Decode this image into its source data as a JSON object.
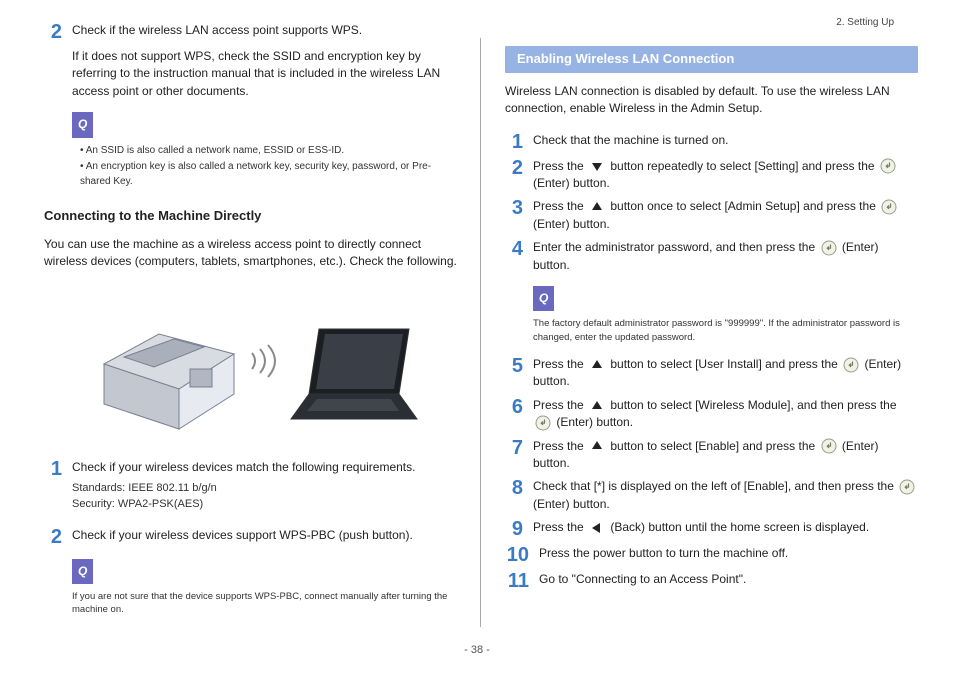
{
  "header": {
    "section": "2. Setting Up"
  },
  "page_number": "- 38 -",
  "left": {
    "step2_main": "Check if the wireless LAN access point supports WPS.",
    "step2_detail": "If it does not support WPS, check the SSID and encryption key by referring to the instruction manual that is included in the wireless LAN access point or other documents.",
    "memo_bullets": [
      "An SSID is also called a network name, ESSID or ESS-ID.",
      "An encryption key is also called a network key, security key, password, or Pre-shared Key."
    ],
    "subhead": "Connecting to the Machine Directly",
    "subhead_body": "You can use the machine as a wireless access point to directly connect wireless devices (computers, tablets, smartphones, etc.). Check the following.",
    "dc_step1": "Check if your wireless devices match the following requirements.",
    "specs_line1": "Standards: IEEE 802.11 b/g/n",
    "specs_line2": "Security: WPA2-PSK(AES)",
    "dc_step2": "Check if your wireless devices support WPS-PBC (push button).",
    "memo_pbc": "If you are not sure that the device supports WPS-PBC, connect manually after turning the machine on."
  },
  "right": {
    "section_title": "Enabling Wireless LAN Connection",
    "intro": "Wireless LAN connection is disabled by default. To use the wireless LAN connection, enable Wireless in the Admin Setup.",
    "steps": {
      "s1": "Check that the machine is turned on.",
      "s2a": "Press the ",
      "s2b": " button repeatedly to select [Setting] and press the ",
      "s2c": " (Enter) button.",
      "s3a": "Press the ",
      "s3b": " button once to select [Admin Setup] and press the ",
      "s3c": " (Enter) button.",
      "s4a": "Enter the administrator password, and then press the ",
      "s4b": " (Enter) button.",
      "memo4": "The factory default administrator password is \"999999\". If the administrator password is changed, enter the updated password.",
      "s5a": "Press the ",
      "s5b": " button to select [User Install] and press the ",
      "s5c": " (Enter) button.",
      "s6a": "Press the ",
      "s6b": " button to select [Wireless Module], and then press the ",
      "s6c": " (Enter) button.",
      "s7a": "Press the ",
      "s7b": " button to select [Enable] and press the ",
      "s7c": " (Enter) button.",
      "s8a": "Check that [*] is displayed on the left of [Enable], and then press the ",
      "s8b": " (Enter) button.",
      "s9a": "Press the ",
      "s9b": " (Back) button until the home screen is displayed.",
      "s10": "Press the power button to turn the machine off.",
      "s11": "Go to \"Connecting to an Access Point\"."
    }
  }
}
